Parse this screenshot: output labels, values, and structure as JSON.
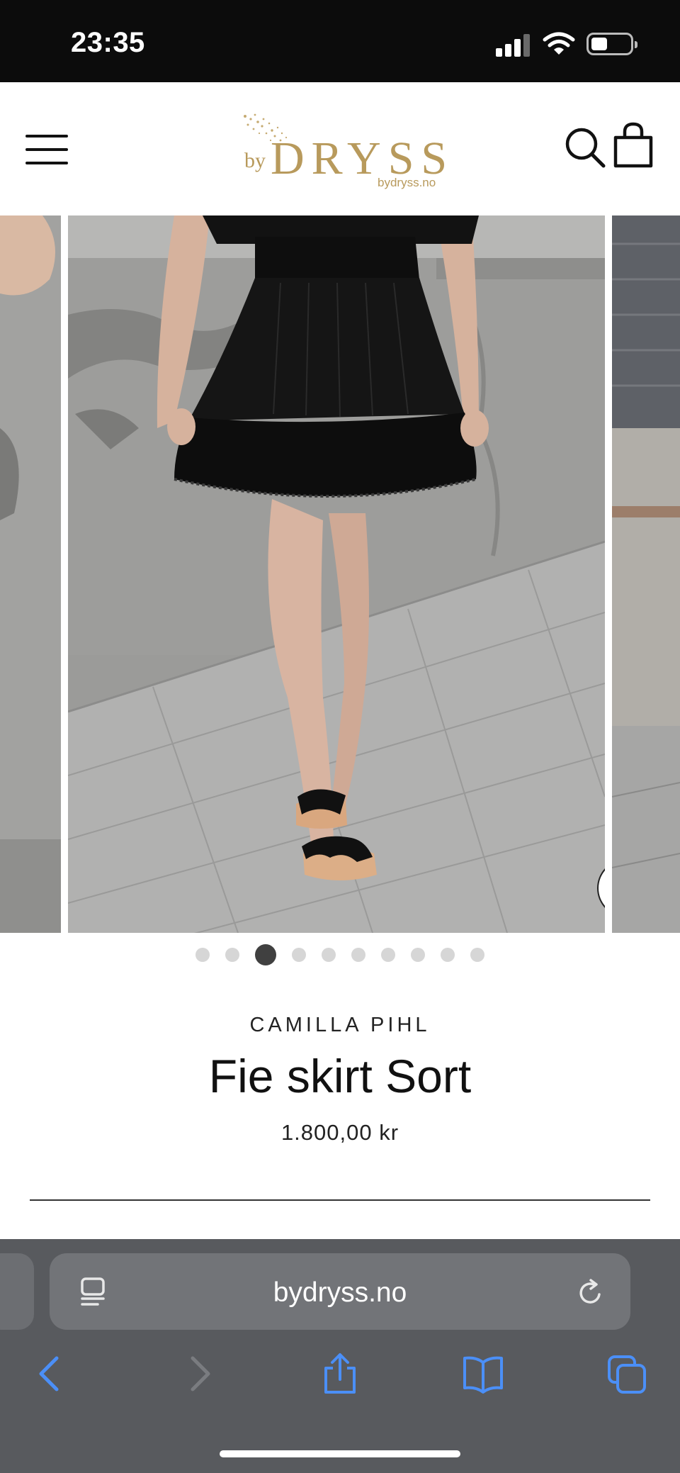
{
  "status_bar": {
    "time": "23:35"
  },
  "header": {
    "logo_prefix": "by",
    "logo_main": "DRYSS",
    "logo_sub": "bydryss.no"
  },
  "gallery": {
    "slide_count": 10,
    "active_index": 2
  },
  "product": {
    "brand": "CAMILLA PIHL",
    "title": "Fie skirt Sort",
    "price": "1.800,00 kr"
  },
  "browser": {
    "url": "bydryss.no"
  },
  "colors": {
    "logo_gold": "#b89a5c",
    "browser_bar": "#585a5e",
    "browser_icon_blue": "#4b8ff7"
  },
  "icons": {
    "menu": "hamburger-icon",
    "search": "search-icon",
    "cart": "shopping-bag-icon",
    "zoom": "zoom-icon",
    "reader": "reader-icon",
    "reload": "reload-icon",
    "back": "chevron-left-icon",
    "forward": "chevron-right-icon",
    "share": "share-icon",
    "bookmarks": "book-icon",
    "tabs": "tabs-icon"
  }
}
